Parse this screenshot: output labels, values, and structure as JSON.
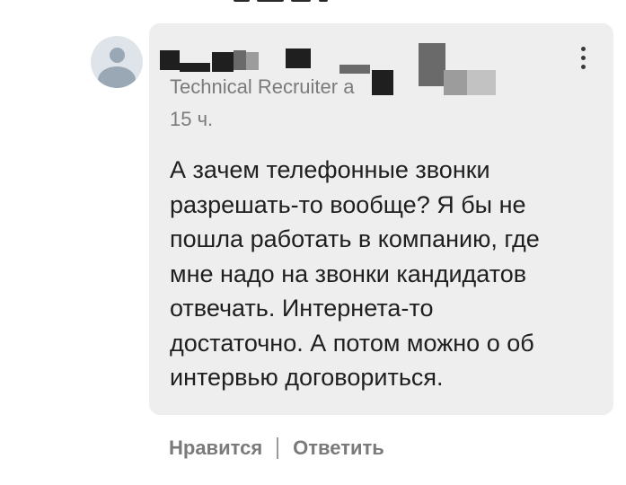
{
  "comment": {
    "author_title": "Technical Recruiter a",
    "timestamp": "15 ч.",
    "text": "А зачем телефонные звонки\nразрешать-то вообще? Я бы не\nпошла работать в компанию, где\nмне надо на звонки кандидатов\nотвечать. Интернета-то\nдостаточно. А потом можно о об\nинтервью договориться.",
    "more_icon": "more-vertical-icon",
    "avatar_icon": "default-user-avatar-icon"
  },
  "actions": {
    "like_label": "Нравится",
    "separator": "|",
    "reply_label": "Ответить"
  },
  "colors": {
    "bubble_background": "#eeeeee",
    "text_primary": "#1f1f1f",
    "text_secondary": "#7b7b7b",
    "avatar_background": "#dfe4ea",
    "avatar_figure": "#9aa7b5"
  }
}
